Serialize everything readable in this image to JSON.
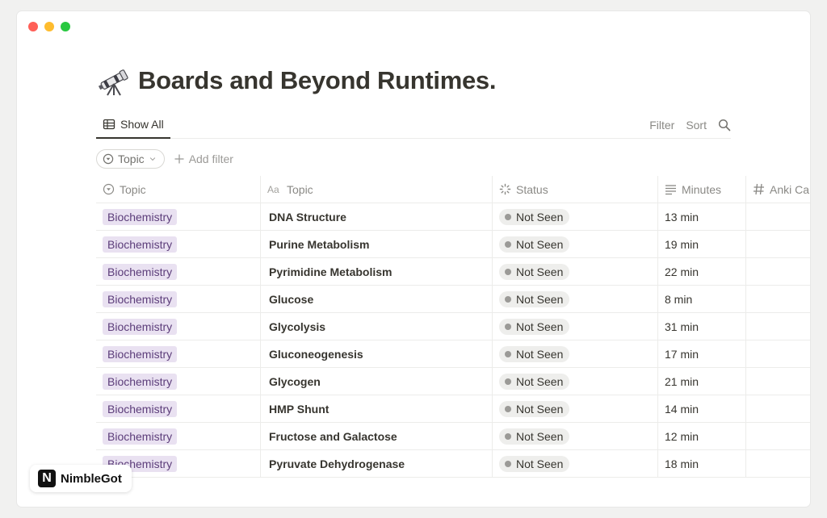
{
  "page": {
    "title": "Boards and Beyond Runtimes.",
    "title_icon": "telescope-icon"
  },
  "views": {
    "active_tab": "Show All",
    "filter_label": "Filter",
    "sort_label": "Sort"
  },
  "filters": {
    "active_filter": "Topic",
    "add_filter_label": "Add filter"
  },
  "table": {
    "columns": [
      "Topic",
      "Topic",
      "Status",
      "Minutes",
      "Anki Ca"
    ],
    "rows": [
      {
        "category": "Biochemistry",
        "topic": "DNA Structure",
        "status": "Not Seen",
        "minutes": "13 min"
      },
      {
        "category": "Biochemistry",
        "topic": "Purine Metabolism",
        "status": "Not Seen",
        "minutes": "19 min"
      },
      {
        "category": "Biochemistry",
        "topic": "Pyrimidine Metabolism",
        "status": "Not Seen",
        "minutes": "22 min"
      },
      {
        "category": "Biochemistry",
        "topic": "Glucose",
        "status": "Not Seen",
        "minutes": "8 min"
      },
      {
        "category": "Biochemistry",
        "topic": "Glycolysis",
        "status": "Not Seen",
        "minutes": "31 min"
      },
      {
        "category": "Biochemistry",
        "topic": "Gluconeogenesis",
        "status": "Not Seen",
        "minutes": "17 min"
      },
      {
        "category": "Biochemistry",
        "topic": "Glycogen",
        "status": "Not Seen",
        "minutes": "21 min"
      },
      {
        "category": "Biochemistry",
        "topic": "HMP Shunt",
        "status": "Not Seen",
        "minutes": "14 min"
      },
      {
        "category": "Biochemistry",
        "topic": "Fructose and Galactose",
        "status": "Not Seen",
        "minutes": "12 min"
      },
      {
        "category": "Biochemistry",
        "topic": "Pyruvate Dehydrogenase",
        "status": "Not Seen",
        "minutes": "18 min"
      }
    ]
  },
  "brand": {
    "logo_letter": "N",
    "name": "NimbleGot"
  },
  "colors": {
    "tag_bg": "#e9e1f1",
    "tag_text": "#5c3d7a",
    "status_bg": "#eeeeec",
    "status_dot": "#9b9a97"
  }
}
